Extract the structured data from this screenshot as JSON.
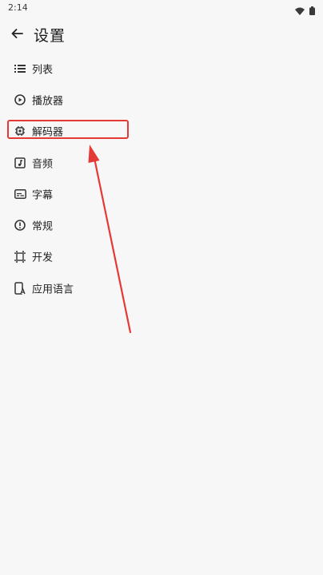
{
  "status_bar": {
    "time": "2:14",
    "icons": [
      "wifi-icon",
      "battery-icon"
    ]
  },
  "app_bar": {
    "back_icon": "arrow-left-icon",
    "title": "设置"
  },
  "menu": {
    "items": [
      {
        "label": "列表",
        "icon": "list-icon"
      },
      {
        "label": "播放器",
        "icon": "player-icon"
      },
      {
        "label": "解码器",
        "icon": "chip-icon"
      },
      {
        "label": "音频",
        "icon": "audio-icon"
      },
      {
        "label": "字幕",
        "icon": "subtitle-icon"
      },
      {
        "label": "常规",
        "icon": "info-icon"
      },
      {
        "label": "开发",
        "icon": "developer-icon"
      },
      {
        "label": "应用语言",
        "icon": "language-icon"
      }
    ]
  },
  "annotation": {
    "highlighted_item": "解码器",
    "color": "#e53935"
  }
}
